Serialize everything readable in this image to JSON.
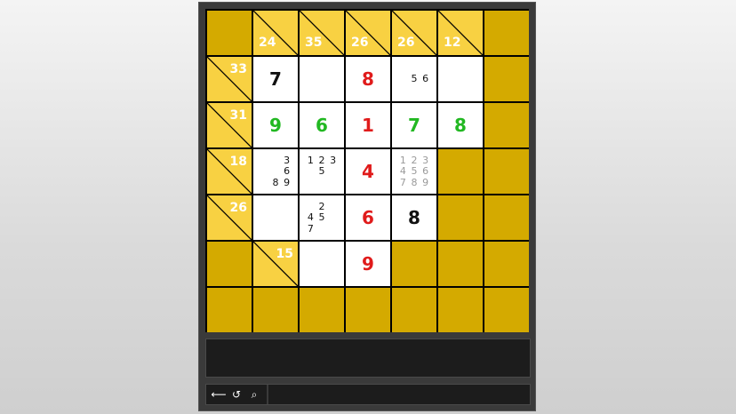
{
  "colors": {
    "clue_bg": "#f8d142",
    "block_bg": "#d4aa00",
    "grid_line": "#000000",
    "given": "#111111",
    "error": "#e01b1b",
    "correct": "#22b822",
    "candidates_dim": "#9a9a9a"
  },
  "board": {
    "rows": [
      [
        {
          "type": "block"
        },
        {
          "type": "clue",
          "down": "24"
        },
        {
          "type": "clue",
          "down": "35"
        },
        {
          "type": "clue",
          "down": "26"
        },
        {
          "type": "clue",
          "down": "26"
        },
        {
          "type": "clue",
          "down": "12"
        },
        {
          "type": "block"
        }
      ],
      [
        {
          "type": "clue",
          "across": "33"
        },
        {
          "type": "input",
          "value": "7",
          "color": "black"
        },
        {
          "type": "input"
        },
        {
          "type": "input",
          "value": "8",
          "color": "red"
        },
        {
          "type": "input",
          "candidates": [
            "",
            "",
            "",
            "",
            "5",
            "6",
            "",
            "",
            ""
          ]
        },
        {
          "type": "input"
        },
        {
          "type": "block"
        }
      ],
      [
        {
          "type": "clue",
          "across": "31"
        },
        {
          "type": "input",
          "value": "9",
          "color": "green"
        },
        {
          "type": "input",
          "value": "6",
          "color": "green"
        },
        {
          "type": "input",
          "value": "1",
          "color": "red"
        },
        {
          "type": "input",
          "value": "7",
          "color": "green"
        },
        {
          "type": "input",
          "value": "8",
          "color": "green"
        },
        {
          "type": "block"
        }
      ],
      [
        {
          "type": "clue",
          "across": "18"
        },
        {
          "type": "input",
          "candidates": [
            "",
            "",
            "3",
            "",
            "",
            "6",
            "",
            "8",
            "9"
          ]
        },
        {
          "type": "input",
          "candidates": [
            "1",
            "2",
            "3",
            "",
            "5",
            "",
            "",
            "",
            ""
          ]
        },
        {
          "type": "input",
          "value": "4",
          "color": "red"
        },
        {
          "type": "input",
          "candidates": [
            "1",
            "2",
            "3",
            "4",
            "5",
            "6",
            "7",
            "8",
            "9"
          ],
          "dim": true
        },
        {
          "type": "block"
        },
        {
          "type": "block"
        }
      ],
      [
        {
          "type": "clue",
          "across": "26"
        },
        {
          "type": "input"
        },
        {
          "type": "input",
          "candidates": [
            "",
            "2",
            "",
            "4",
            "5",
            "",
            "7",
            "",
            ""
          ]
        },
        {
          "type": "input",
          "value": "6",
          "color": "red"
        },
        {
          "type": "input",
          "value": "8",
          "color": "black"
        },
        {
          "type": "block"
        },
        {
          "type": "block"
        }
      ],
      [
        {
          "type": "block"
        },
        {
          "type": "clue",
          "across": "15"
        },
        {
          "type": "input"
        },
        {
          "type": "input",
          "value": "9",
          "color": "red"
        },
        {
          "type": "block"
        },
        {
          "type": "block"
        },
        {
          "type": "block"
        }
      ],
      [
        {
          "type": "block"
        },
        {
          "type": "block"
        },
        {
          "type": "block"
        },
        {
          "type": "block"
        },
        {
          "type": "block"
        },
        {
          "type": "block"
        },
        {
          "type": "block"
        }
      ]
    ]
  },
  "toolbar": {
    "undo_glyph": "⟵",
    "restart_glyph": "↺",
    "search_glyph": "⌕"
  }
}
